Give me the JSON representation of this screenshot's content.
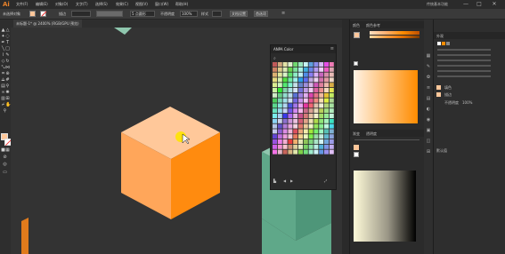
{
  "app": {
    "logo": "Ai",
    "menu": [
      "文件(F)",
      "编辑(E)",
      "对象(O)",
      "文字(T)",
      "选择(S)",
      "效果(C)",
      "视图(V)",
      "窗口(W)",
      "帮助(H)"
    ],
    "workspace": "传统基本功能",
    "window_controls": [
      "—",
      "□",
      "✕"
    ]
  },
  "control_bar": {
    "selection_label": "未选择对象",
    "stroke_label": "描边",
    "stroke_value": "",
    "brush_value": "5 点圆形",
    "opacity_label": "不透明度",
    "opacity_value": "100%",
    "style_label": "样式",
    "doc_setup_label": "文档设置",
    "prefs_label": "首选项"
  },
  "document": {
    "tab_title": "未标题-1* @ 2400% (RGB/GPU 预览)"
  },
  "swatch_panel": {
    "title": "ANPA Color"
  },
  "right_panels": {
    "color_guide_tab": "颜色参考",
    "color_tab": "颜色",
    "swatches_tab": "色板",
    "brushes_tab": "画笔",
    "symbols_tab": "符号",
    "gradient_tab": "渐变",
    "transparency_tab": "透明度",
    "appearance_title": "外观",
    "appearance_fill": "填色",
    "appearance_stroke": "描边",
    "appearance_opacity_label": "不透明度",
    "appearance_opacity_value": "100%",
    "appearance_default": "默认值",
    "layers_tab": "图层"
  },
  "colors": {
    "accent_orange": "#ff8c00",
    "cube_top": "#ffc89a",
    "cube_left": "#ffa65a",
    "cube_right": "#ff8b0f",
    "teal_top": "#8fc7ae",
    "teal_side": "#5fa889",
    "fill_swatch": "#ffc79a",
    "canvas_bg": "#333333"
  },
  "icons": [
    "selection-tool-icon",
    "direct-selection-icon",
    "pen-tool-icon",
    "type-tool-icon",
    "line-tool-icon",
    "rectangle-tool-icon",
    "brush-tool-icon",
    "pencil-tool-icon",
    "eraser-tool-icon",
    "rotate-tool-icon",
    "scale-tool-icon",
    "width-tool-icon",
    "free-transform-icon",
    "shape-builder-icon",
    "perspective-icon",
    "mesh-tool-icon",
    "gradient-tool-icon",
    "eyedropper-tool-icon",
    "blend-tool-icon",
    "symbol-sprayer-icon",
    "graph-tool-icon",
    "artboard-tool-icon",
    "slice-tool-icon",
    "hand-tool-icon",
    "zoom-tool-icon"
  ]
}
